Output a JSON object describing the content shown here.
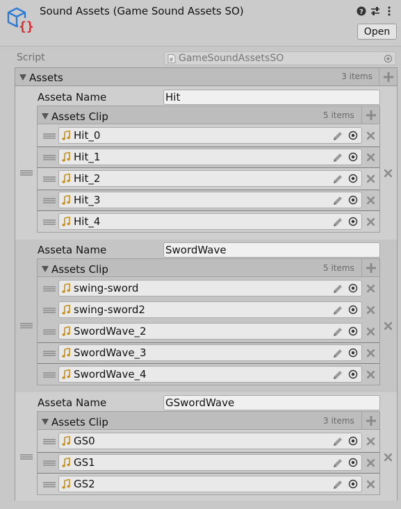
{
  "header": {
    "title": "Sound Assets (Game Sound Assets SO)",
    "open_label": "Open",
    "tools": [
      "help-icon",
      "preset-sliders-icon",
      "more-menu-icon"
    ]
  },
  "script": {
    "label": "Script",
    "value": "GameSoundAssetsSO"
  },
  "assets": {
    "label": "Assets",
    "count": "3 items",
    "items": [
      {
        "name_label": "Asseta Name",
        "name": "Hit",
        "clip_label": "Assets Clip",
        "clip_count": "5 items",
        "clips": [
          "Hit_0",
          "Hit_1",
          "Hit_2",
          "Hit_3",
          "Hit_4"
        ]
      },
      {
        "name_label": "Asseta Name",
        "name": "SwordWave",
        "clip_label": "Assets Clip",
        "clip_count": "5 items",
        "clips": [
          "swing-sword",
          "swing-sword2",
          "SwordWave_2",
          "SwordWave_3",
          "SwordWave_4"
        ]
      },
      {
        "name_label": "Asseta Name",
        "name": "GSwordWave",
        "clip_label": "Assets Clip",
        "clip_count": "3 items",
        "clips": [
          "GS0",
          "GS1",
          "GS2"
        ]
      }
    ]
  },
  "colors": {
    "accent_blue": "#2d7bd6",
    "error_red": "#d8262d",
    "note_gold": "#c8901a"
  }
}
